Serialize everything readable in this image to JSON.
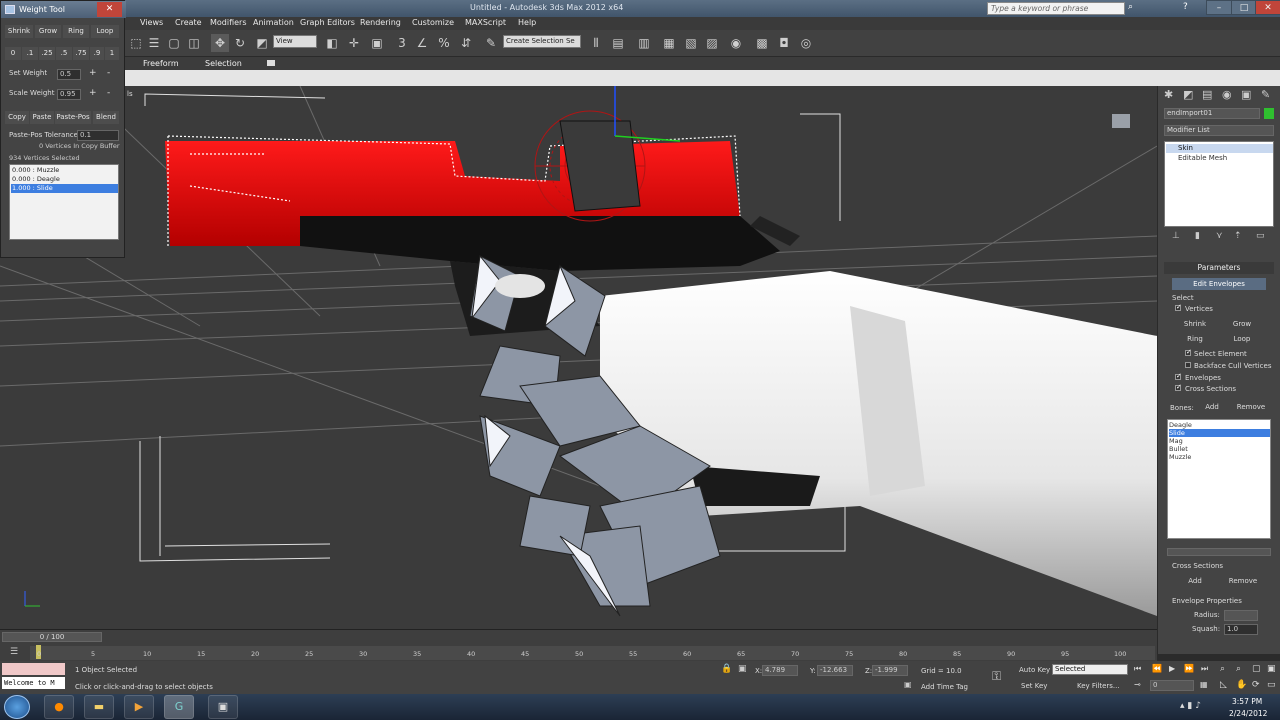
{
  "window": {
    "title": "Untitled - Autodesk 3ds Max 2012 x64",
    "search_placeholder": "Type a keyword or phrase"
  },
  "menu": [
    "Views",
    "Create",
    "Modifiers",
    "Animation",
    "Graph Editors",
    "Rendering",
    "Customize",
    "MAXScript",
    "Help"
  ],
  "toolbar": {
    "view_select": "View",
    "named_selection": "Create Selection Se"
  },
  "ribbon": {
    "tabs": [
      "Freeform",
      "Selection"
    ]
  },
  "weight_tool": {
    "title": "Weight Tool",
    "row1": [
      "Shrink",
      "Grow",
      "Ring",
      "Loop"
    ],
    "presets": [
      "0",
      ".1",
      ".25",
      ".5",
      ".75",
      ".9",
      "1"
    ],
    "set_weight_label": "Set Weight",
    "set_weight_value": "0.5",
    "scale_weight_label": "Scale Weight",
    "scale_weight_value": "0.95",
    "copy_row": [
      "Copy",
      "Paste",
      "Paste-Pos",
      "Blend"
    ],
    "tolerance_label": "Paste-Pos Tolerance",
    "tolerance_value": "0.1",
    "copy_buffer": "0 Vertices In Copy Buffer",
    "selected_count": "934 Vertices Selected",
    "list": [
      "0.000 : Muzzle",
      "0.000 : Deagle",
      "1.000 : Slide"
    ],
    "selected_index": 2
  },
  "command_panel": {
    "object_name": "endImport01",
    "modifier_list_label": "Modifier List",
    "stack": [
      "Skin",
      "Editable Mesh"
    ],
    "parameters_title": "Parameters",
    "edit_envelopes": "Edit Envelopes",
    "select_label": "Select",
    "vertices": "Vertices",
    "shrink": "Shrink",
    "grow": "Grow",
    "ring": "Ring",
    "loop": "Loop",
    "select_element": "Select Element",
    "backface_cull": "Backface Cull Vertices",
    "envelopes": "Envelopes",
    "cross_sections": "Cross Sections",
    "bones_label": "Bones:",
    "add": "Add",
    "remove": "Remove",
    "bones": [
      "Deagle",
      "Slide",
      "Mag",
      "Bullet",
      "Muzzle"
    ],
    "bones_selected": 1,
    "cross_sections_title": "Cross Sections",
    "envelope_props": "Envelope Properties",
    "radius_label": "Radius:",
    "squash_label": "Squash:",
    "squash_value": "1.0"
  },
  "timeline": {
    "frame_label": "0 / 100",
    "ticks": [
      "0",
      "5",
      "10",
      "15",
      "20",
      "25",
      "30",
      "35",
      "40",
      "45",
      "50",
      "55",
      "60",
      "65",
      "70",
      "75",
      "80",
      "85",
      "90",
      "95",
      "100"
    ]
  },
  "status": {
    "listener": "Welcome to M",
    "objects_selected": "1 Object Selected",
    "prompt": "Click or click-and-drag to select objects",
    "x_label": "X:",
    "x_value": "4.789",
    "y_label": "Y:",
    "y_value": "-12.663",
    "z_label": "Z:",
    "z_value": "-1.999",
    "grid": "Grid = 10.0",
    "add_time_tag": "Add Time Tag",
    "auto_key": "Auto Key",
    "set_key": "Set Key",
    "key_mode": "Selected",
    "key_filters": "Key Filters...",
    "current_frame": "0"
  },
  "taskbar": {
    "time": "3:57 PM",
    "date": "2/24/2012"
  }
}
